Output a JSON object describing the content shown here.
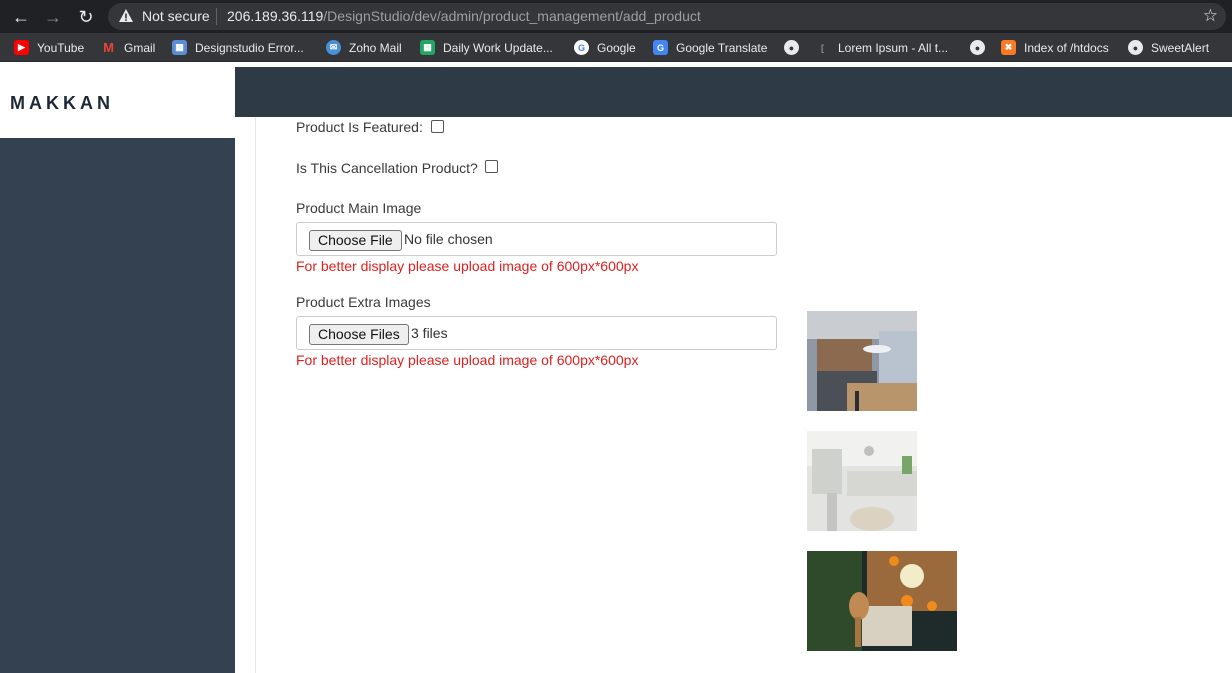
{
  "browser": {
    "security_label": "Not secure",
    "url_host": "206.189.36.119",
    "url_path": "/DesignStudio/dev/admin/product_management/add_product",
    "bookmarks": [
      {
        "label": "YouTube",
        "icon": "youtube-icon",
        "color": "#ff0000"
      },
      {
        "label": "Gmail",
        "icon": "gmail-icon",
        "color": "#ea4335"
      },
      {
        "label": "Designstudio Error...",
        "icon": "document-icon",
        "color": "#5b8dd6"
      },
      {
        "label": "Zoho Mail",
        "icon": "zoho-mail-icon",
        "color": "#4a90d9"
      },
      {
        "label": "Daily Work Update...",
        "icon": "sheets-icon",
        "color": "#23a566"
      },
      {
        "label": "Google",
        "icon": "google-icon",
        "color": "#4285f4"
      },
      {
        "label": "Google Translate",
        "icon": "translate-icon",
        "color": "#4285f4"
      },
      {
        "label": "",
        "icon": "globe-icon",
        "color": "#e8eaed"
      },
      {
        "label": "Lorem Ipsum - All t...",
        "icon": "bookmark-icon",
        "color": "#8a8d91"
      },
      {
        "label": "",
        "icon": "globe-icon",
        "color": "#e8eaed"
      },
      {
        "label": "Index of /htdocs",
        "icon": "xampp-icon",
        "color": "#fb7a24"
      },
      {
        "label": "SweetAlert",
        "icon": "globe-icon",
        "color": "#e8eaed"
      }
    ]
  },
  "app": {
    "brand": "MAKKAN"
  },
  "form": {
    "featured_label": "Product Is Featured:",
    "cancellation_label": "Is This Cancellation Product?",
    "main_image": {
      "label": "Product Main Image",
      "button": "Choose File",
      "status": "No file chosen",
      "hint": "For better display please upload image of 600px*600px"
    },
    "extra_images": {
      "label": "Product Extra Images",
      "button": "Choose Files",
      "status": "3 files",
      "hint": "For better display please upload image of 600px*600px"
    }
  },
  "colors": {
    "sidebar": "#344150",
    "topbar": "#2f3a47",
    "hint": "#e02020"
  }
}
